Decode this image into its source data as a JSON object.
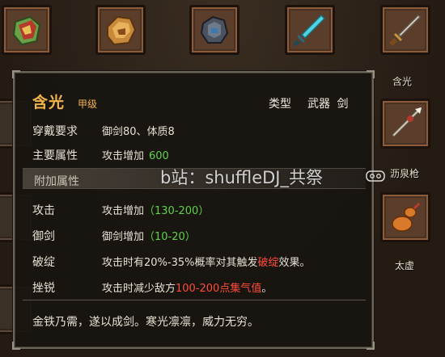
{
  "background_slots": [
    {
      "icon": "green-gauntlet-icon",
      "label": ""
    },
    {
      "icon": "gold-gauntlet-icon",
      "label": ""
    },
    {
      "icon": "iron-gauntlet-icon",
      "label": ""
    },
    {
      "icon": "cyan-sword-icon",
      "label": ""
    },
    {
      "icon": "sword-icon",
      "label": "含光"
    },
    {
      "icon": "spear-icon",
      "label": "沥泉枪"
    },
    {
      "icon": "gourd-icon",
      "label": "太虚"
    }
  ],
  "tooltip": {
    "name": "含光",
    "grade": "甲级",
    "type_label": "类型",
    "type_value": "武器 剑",
    "requirement": {
      "label": "穿戴要求",
      "value": "御剑80、体质8"
    },
    "main_attr": {
      "label": "主要属性",
      "text": "攻击增加",
      "value": "600"
    },
    "extra_header": "附加属性",
    "attrs": [
      {
        "label": "攻击",
        "text": "攻击增加",
        "value": "（130-200）"
      },
      {
        "label": "御剑",
        "text": "御剑增加",
        "value": "（10-20）"
      }
    ],
    "special_1": {
      "label": "破绽",
      "pre": "攻击时有20%-35%概率对其触发",
      "highlight": "破绽",
      "post": "效果。"
    },
    "special_2": {
      "label": "挫锐",
      "pre": "攻击时减少敌方",
      "highlight": "100-200点集气值",
      "post": "。"
    },
    "flavor": "金铁乃需，遂以成剑。寒光凛凛，威力无穷。"
  },
  "watermark": "b站：shuffleDJ_共祭",
  "colors": {
    "title": "#f2b44a",
    "green_value": "#5fd24a",
    "red_value": "#ff4b3a"
  }
}
